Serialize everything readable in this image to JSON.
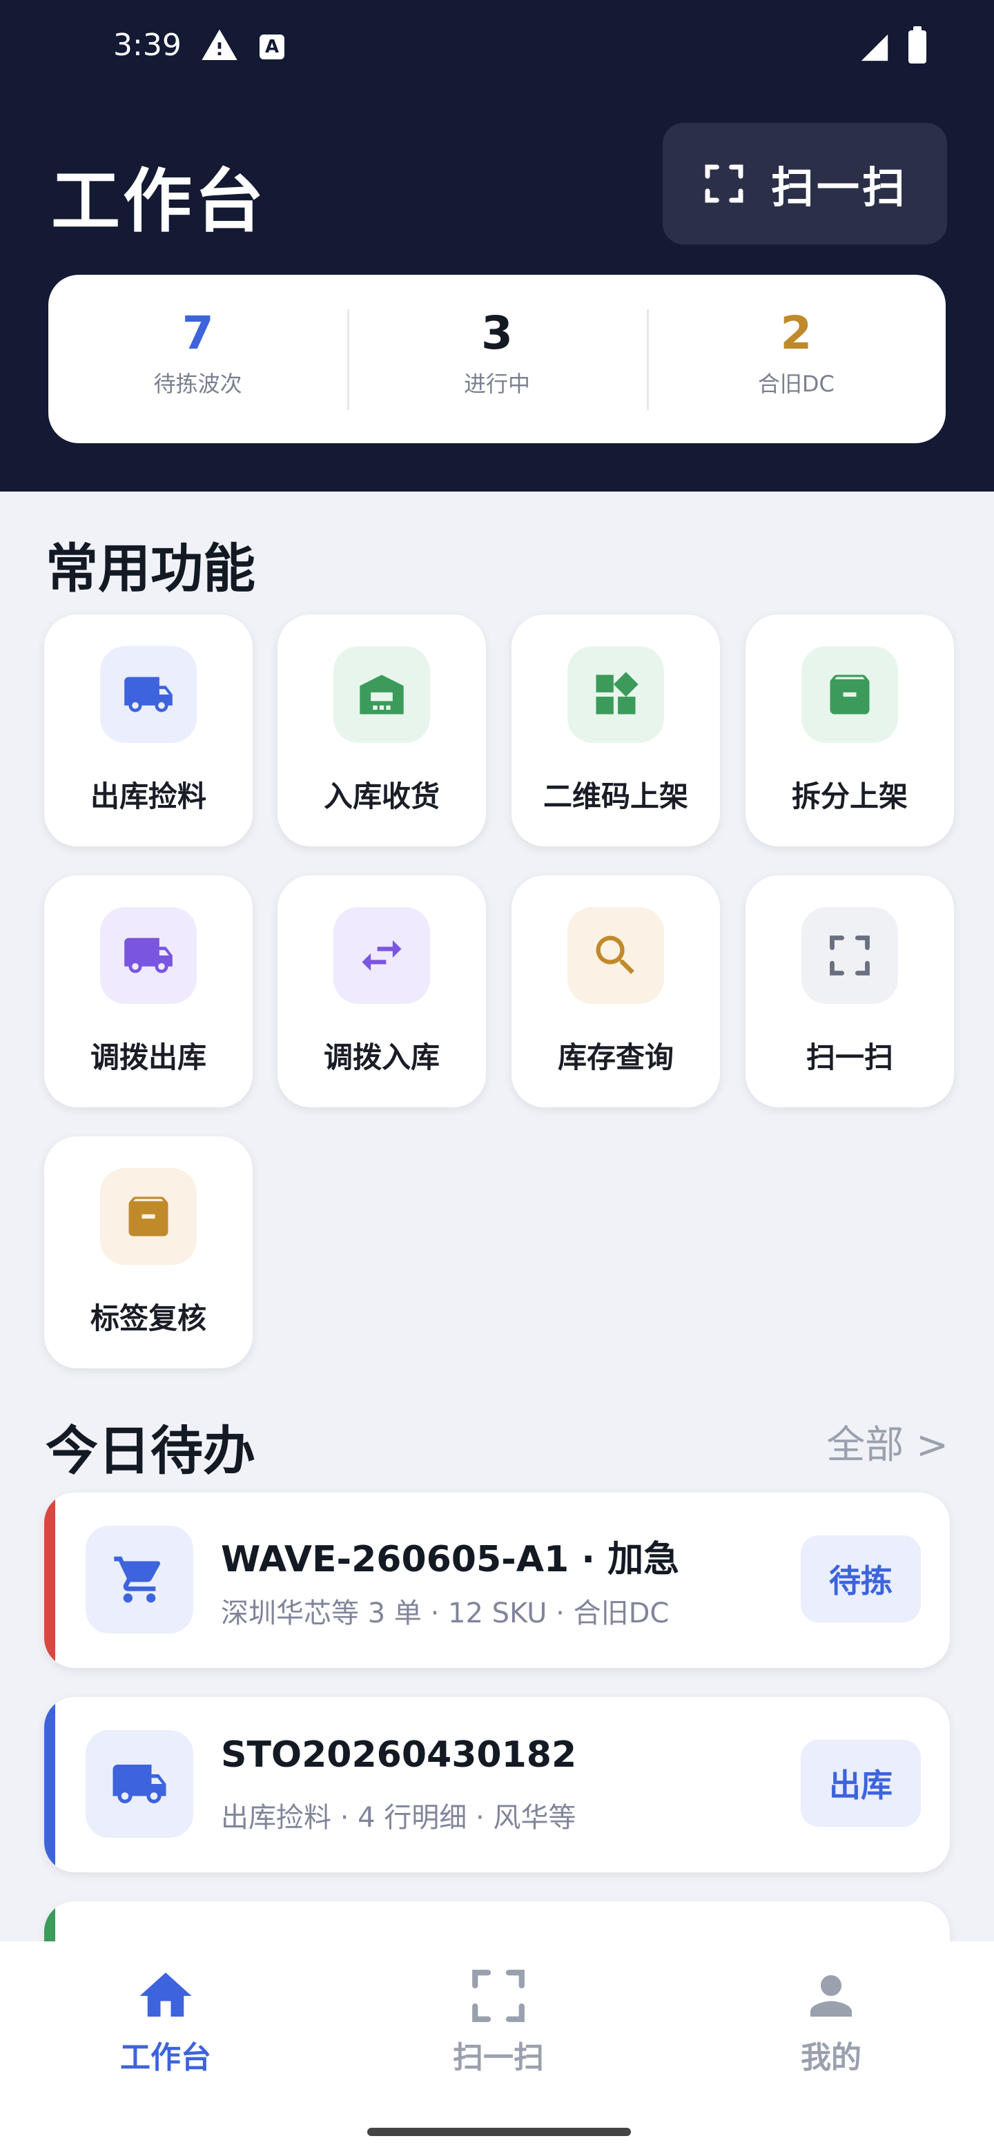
{
  "status_bar": {
    "time": "3:39",
    "badge": "A"
  },
  "header": {
    "title": "工作台",
    "scan_button_label": "扫一扫"
  },
  "stats": [
    {
      "value": "7",
      "label": "待拣波次",
      "color": "#3d63dd"
    },
    {
      "value": "3",
      "label": "进行中",
      "color": "#141a24"
    },
    {
      "value": "2",
      "label": "合旧DC",
      "color": "#c08a2a"
    }
  ],
  "functions": {
    "title": "常用功能",
    "items": [
      {
        "label": "出库捡料",
        "icon": "truck-icon",
        "bg": "#eaeefd",
        "fg": "#3d63dd"
      },
      {
        "label": "入库收货",
        "icon": "warehouse-icon",
        "bg": "#e8f5ec",
        "fg": "#3c9a5a"
      },
      {
        "label": "二维码上架",
        "icon": "widgets-icon",
        "bg": "#e8f5ec",
        "fg": "#3c9a5a"
      },
      {
        "label": "拆分上架",
        "icon": "archive-icon",
        "bg": "#e8f5ec",
        "fg": "#3c9a5a"
      },
      {
        "label": "调拨出库",
        "icon": "truck-icon",
        "bg": "#efeafd",
        "fg": "#7a55e0"
      },
      {
        "label": "调拨入库",
        "icon": "swap-icon",
        "bg": "#efeafd",
        "fg": "#7a55e0"
      },
      {
        "label": "库存查询",
        "icon": "search-icon",
        "bg": "#fbf1e4",
        "fg": "#c08a2a"
      },
      {
        "label": "扫一扫",
        "icon": "scan-icon",
        "bg": "#f0f1f4",
        "fg": "#6b7080"
      },
      {
        "label": "标签复核",
        "icon": "archive-icon",
        "bg": "#fbf1e4",
        "fg": "#c08a2a"
      }
    ]
  },
  "todos": {
    "title": "今日待办",
    "more_label": "全部 >",
    "items": [
      {
        "title": "WAVE-260605-A1 · 加急",
        "subtitle": "深圳华芯等 3 单 · 12 SKU · 合旧DC",
        "badge": "待拣",
        "bar_color": "#d9473f",
        "icon": "cart-icon"
      },
      {
        "title": "STO20260430182",
        "subtitle": "出库捡料 · 4 行明细 · 风华等",
        "badge": "出库",
        "bar_color": "#3d63dd",
        "icon": "truck-icon"
      }
    ]
  },
  "nav": [
    {
      "label": "工作台",
      "icon": "home-icon",
      "active": true
    },
    {
      "label": "扫一扫",
      "icon": "scan-icon",
      "active": false
    },
    {
      "label": "我的",
      "icon": "person-icon",
      "active": false
    }
  ],
  "colors": {
    "header_bg": "#141a33",
    "accent": "#3d63dd",
    "page_bg": "#f0f2f7",
    "inactive": "#9aa0ad"
  }
}
